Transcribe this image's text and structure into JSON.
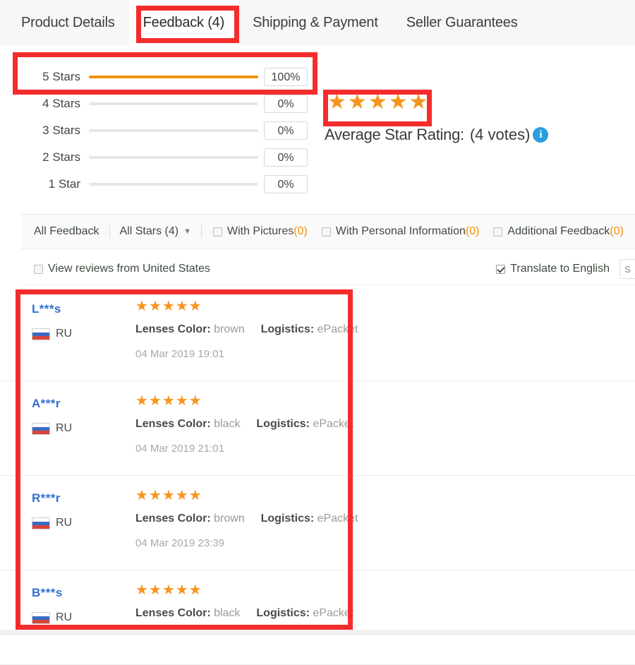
{
  "tabs": [
    {
      "label": "Product Details",
      "active": false
    },
    {
      "label": "Feedback (4)",
      "active": true
    },
    {
      "label": "Shipping & Payment",
      "active": false
    },
    {
      "label": "Seller Guarantees",
      "active": false
    }
  ],
  "rating_summary": {
    "bars": [
      {
        "label": "5 Stars",
        "percent_label": "100%",
        "percent": 100
      },
      {
        "label": "4 Stars",
        "percent_label": "0%",
        "percent": 0
      },
      {
        "label": "3 Stars",
        "percent_label": "0%",
        "percent": 0
      },
      {
        "label": "2 Stars",
        "percent_label": "0%",
        "percent": 0
      },
      {
        "label": "1 Star",
        "percent_label": "0%",
        "percent": 0
      }
    ],
    "average_stars_filled": 5,
    "average_label": "Average Star Rating:",
    "votes_label": "(4 votes)",
    "info_glyph": "i",
    "star_glyph": "★"
  },
  "filters": {
    "all_feedback": "All Feedback",
    "all_stars": "All Stars (4)",
    "caret_glyph": "▼",
    "checkboxes": [
      {
        "label": "With Pictures ",
        "count": "(0)",
        "checked": false
      },
      {
        "label": "With Personal Information",
        "count": "(0)",
        "checked": false
      },
      {
        "label": "Additional Feedback ",
        "count": "(0)",
        "checked": false
      }
    ]
  },
  "options_row": {
    "view_reviews_label": "View reviews from United States",
    "view_reviews_checked": false,
    "translate_label": "Translate to English",
    "translate_checked": true,
    "cut_off_text": "S"
  },
  "reviews": [
    {
      "name": "L***s",
      "country_code": "RU",
      "stars": 5,
      "attr1_key": "Lenses Color:",
      "attr1_val": "brown",
      "attr2_key": "Logistics:",
      "attr2_val": "ePacket",
      "date": "04 Mar 2019 19:01"
    },
    {
      "name": "A***r",
      "country_code": "RU",
      "stars": 5,
      "attr1_key": "Lenses Color:",
      "attr1_val": "black",
      "attr2_key": "Logistics:",
      "attr2_val": "ePacket",
      "date": "04 Mar 2019 21:01"
    },
    {
      "name": "R***r",
      "country_code": "RU",
      "stars": 5,
      "attr1_key": "Lenses Color:",
      "attr1_val": "brown",
      "attr2_key": "Logistics:",
      "attr2_val": "ePacket",
      "date": "04 Mar 2019 23:39"
    },
    {
      "name": "B***s",
      "country_code": "RU",
      "stars": 5,
      "attr1_key": "Lenses Color:",
      "attr1_val": "black",
      "attr2_key": "Logistics:",
      "attr2_val": "ePacket",
      "date": ""
    }
  ],
  "colors": {
    "star_orange": "#f7941d",
    "bar_orange": "#f0920a",
    "link_blue": "#2f6fd0",
    "annotation_red": "#f42c2c",
    "info_blue": "#2a9ee0"
  }
}
